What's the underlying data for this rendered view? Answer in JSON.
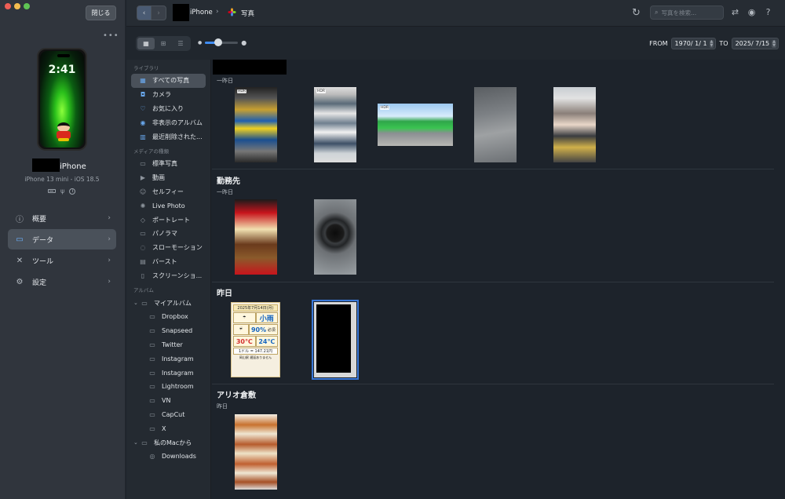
{
  "window": {
    "close_label": "閉じる",
    "more_icon": "ellipsis-icon"
  },
  "device": {
    "lock_time": "2:41",
    "name": "iPhone",
    "model": "iPhone 13 mini - iOS 18.5"
  },
  "nav": [
    {
      "label": "概要",
      "icon": "info-icon"
    },
    {
      "label": "データ",
      "icon": "data-icon",
      "active": true
    },
    {
      "label": "ツール",
      "icon": "tools-icon"
    },
    {
      "label": "設定",
      "icon": "gear-icon"
    }
  ],
  "breadcrumb": {
    "device": "iPhone",
    "separator": "›",
    "section": "写真"
  },
  "search": {
    "placeholder": "写真を検索..."
  },
  "date_filter": {
    "from_label": "FROM",
    "from_value": "1970/  1/  1",
    "to_label": "TO",
    "to_value": "2025/  7/15"
  },
  "zoom": {
    "level": 0.4
  },
  "library": {
    "section_library": "ライブラリ",
    "items": [
      {
        "label": "すべての写真",
        "active": true
      },
      {
        "label": "カメラ"
      },
      {
        "label": "お気に入り"
      },
      {
        "label": "非表示のアルバム"
      },
      {
        "label": "最近削除された..."
      }
    ],
    "section_media": "メディアの種類",
    "media": [
      "標準写真",
      "動画",
      "セルフィー",
      "Live Photo",
      "ポートレート",
      "パノラマ",
      "スローモーション",
      "バースト",
      "スクリーンショ..."
    ],
    "section_albums": "アルバム",
    "my_albums": "マイアルバム",
    "albums": [
      "Dropbox",
      "Snapseed",
      "Twitter",
      "Instagram",
      "Instagram",
      "Lightroom",
      "VN",
      "CapCut",
      "X"
    ],
    "from_mac": "私のMacから",
    "mac_albums": [
      "Downloads"
    ]
  },
  "sections": [
    {
      "title": "",
      "subtitle": "一昨日"
    },
    {
      "title": "勤務先",
      "subtitle": "一昨日"
    },
    {
      "title": "昨日",
      "subtitle": ""
    },
    {
      "title": "アリオ倉敷",
      "subtitle": "昨日"
    }
  ],
  "photo_badges": {
    "hdr": "HDR"
  },
  "weather_card": {
    "date": "2025年7月14日(月)",
    "weather": "小雨",
    "humidity": "90%",
    "humidity_label": "必須",
    "high": "30℃",
    "low": "24℃",
    "fx": "1ドル = 147.21円",
    "footer": "岡山駅 遅延ありません"
  },
  "colors": {
    "accent": "#3f8df5",
    "sidebar_bg": "#30353d",
    "content_bg": "#1d232b",
    "selection": "#3a78d8"
  }
}
